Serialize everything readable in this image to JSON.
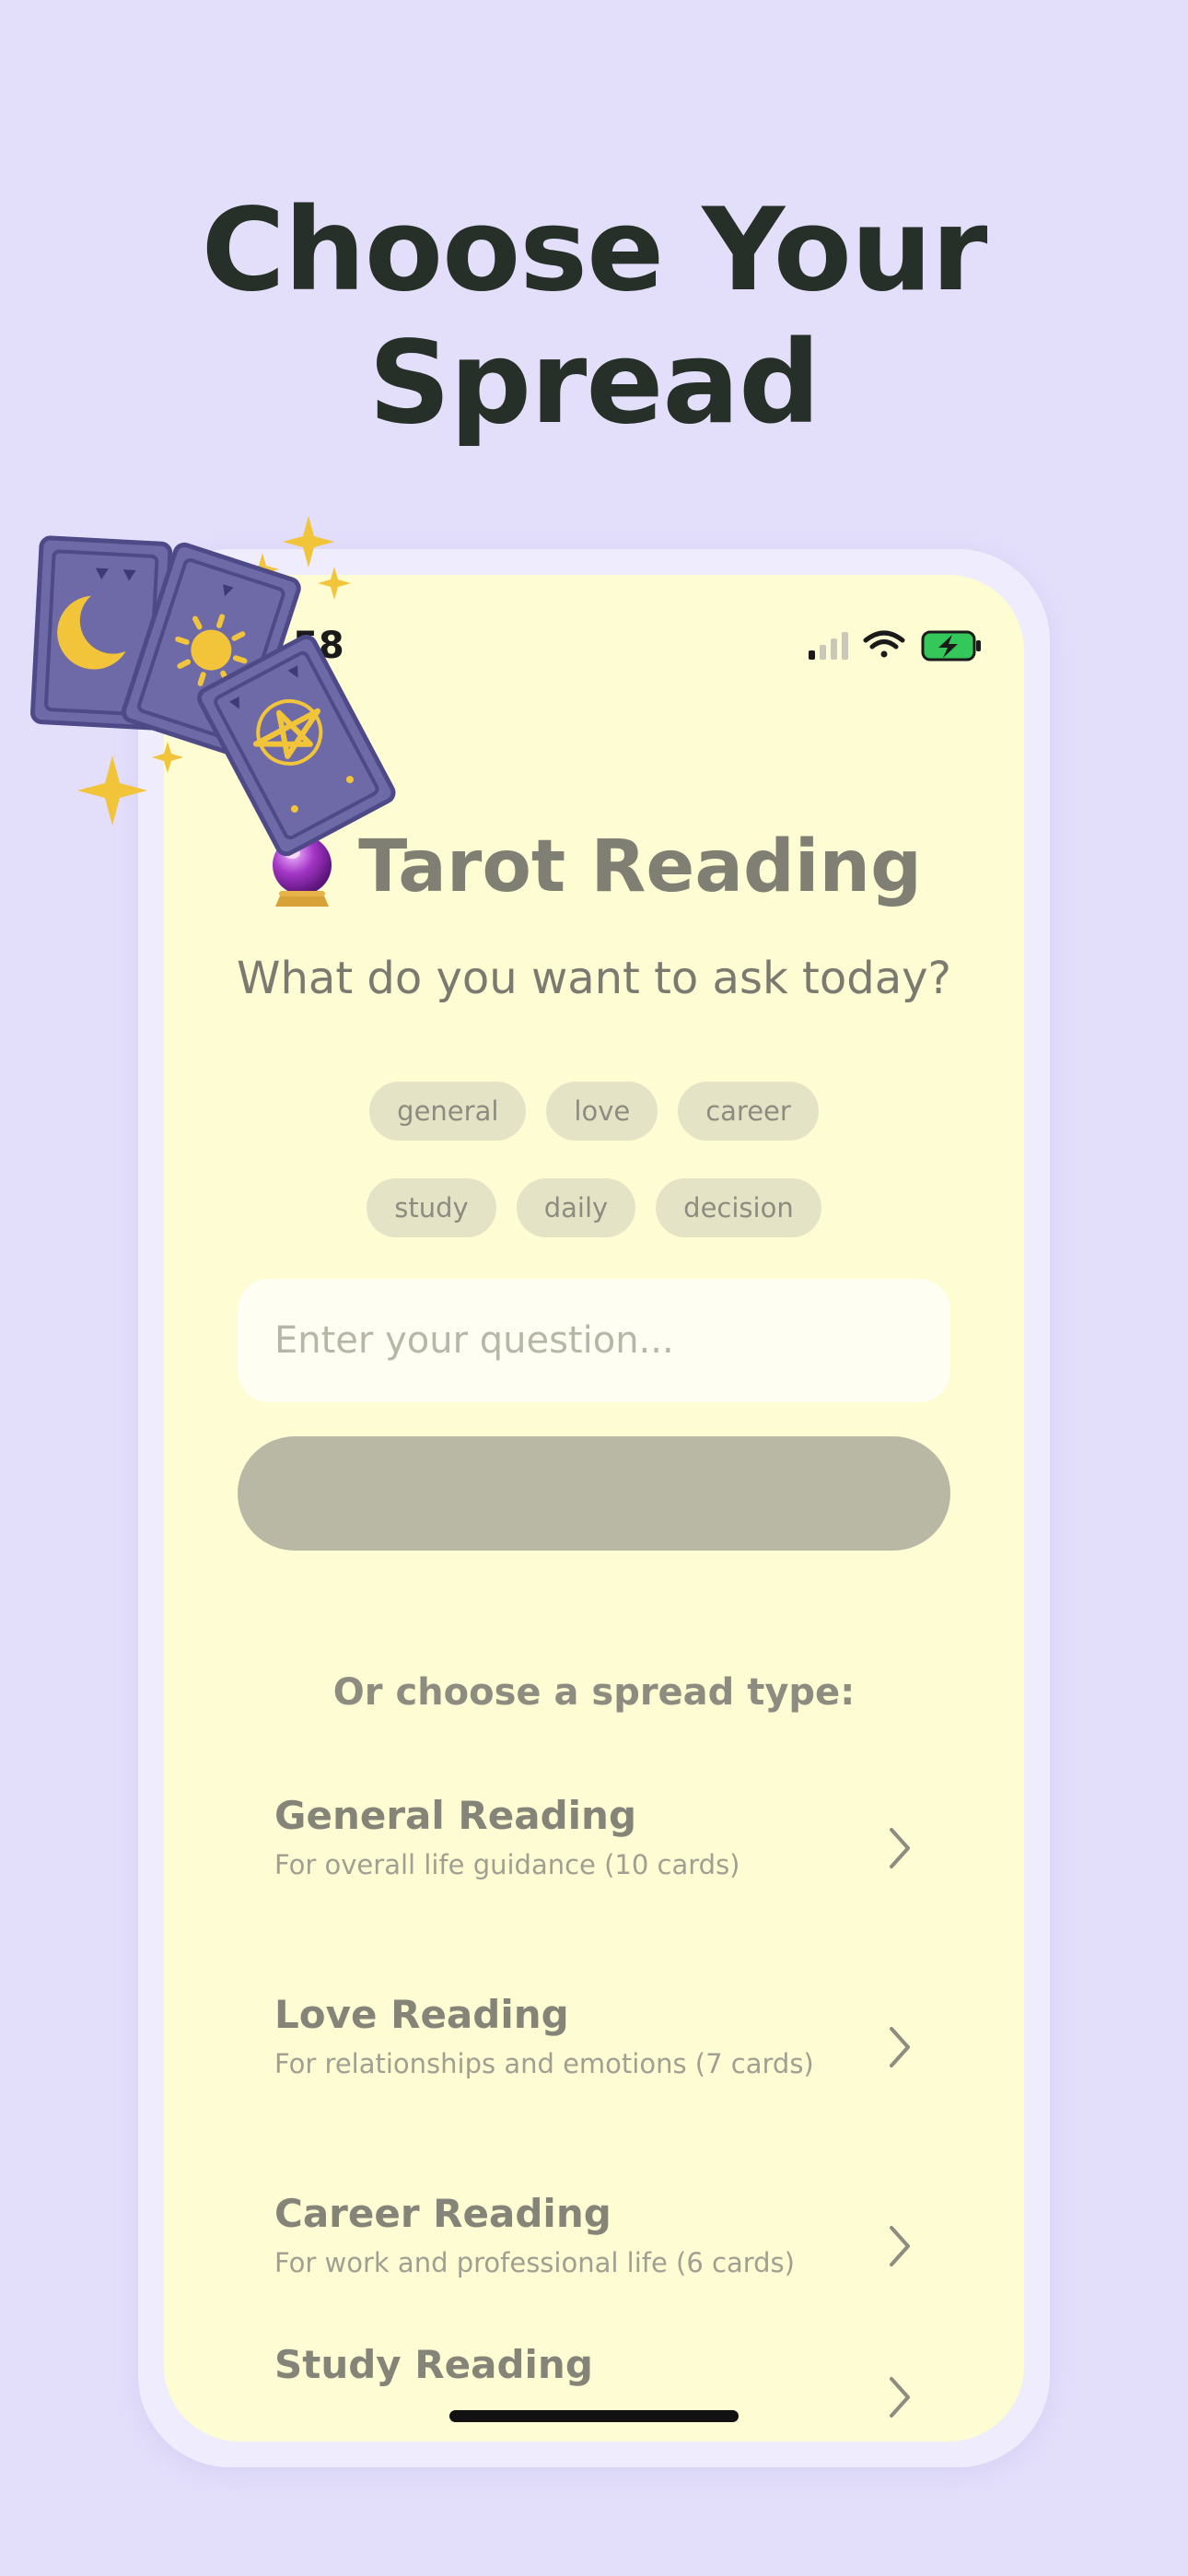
{
  "hero": {
    "title": "Choose Your Spread"
  },
  "status_bar": {
    "time": "58"
  },
  "app": {
    "title": "Tarot Reading",
    "subtitle": "What do you want to ask today?"
  },
  "categories": {
    "row1": [
      "general",
      "love",
      "career"
    ],
    "row2": [
      "study",
      "daily",
      "decision"
    ]
  },
  "question_input": {
    "placeholder": "Enter your question..."
  },
  "spread_section": {
    "label": "Or choose a spread type:",
    "items": [
      {
        "title": "General Reading",
        "desc": "For overall life guidance (10 cards)"
      },
      {
        "title": "Love Reading",
        "desc": "For relationships and emotions (7 cards)"
      },
      {
        "title": "Career Reading",
        "desc": "For work and professional life (6 cards)"
      },
      {
        "title": "Study Reading",
        "desc": ""
      }
    ]
  },
  "colors": {
    "background": "#e3dffb",
    "screen": "#fefcd3",
    "card": "#6e6aa8",
    "gold": "#f2c43a"
  }
}
